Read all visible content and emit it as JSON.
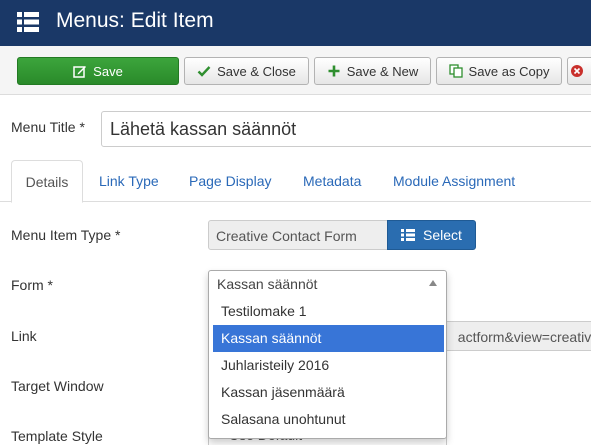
{
  "header": {
    "title": "Menus: Edit Item",
    "icon": "list-icon"
  },
  "toolbar": {
    "save": "Save",
    "save_close": "Save & Close",
    "save_new": "Save & New",
    "save_as_copy": "Save as Copy"
  },
  "form": {
    "menu_title_label": "Menu Title *",
    "menu_title_value": "Lähetä kassan säännöt",
    "tabs": [
      "Details",
      "Link Type",
      "Page Display",
      "Metadata",
      "Module Assignment"
    ],
    "menu_item_type_label": "Menu Item Type *",
    "menu_item_type_value": "Creative Contact Form",
    "select_label": "Select",
    "form_label": "Form *",
    "link_label": "Link",
    "link_value": "actform&view=creative",
    "target_window_label": "Target Window",
    "template_style_label": "Template Style",
    "template_style_value": "Use Default"
  },
  "dropdown": {
    "selected": "Kassan säännöt",
    "options": [
      "Testilomake 1",
      "Kassan säännöt",
      "Juhlaristeily 2016",
      "Kassan jäsenmäärä",
      "Salasana unohtunut"
    ],
    "highlighted_index": 1
  },
  "colors": {
    "header_bg": "#1a3867",
    "save_green": "#2f982f",
    "select_blue": "#2a6db0",
    "highlight": "#3875d7"
  }
}
